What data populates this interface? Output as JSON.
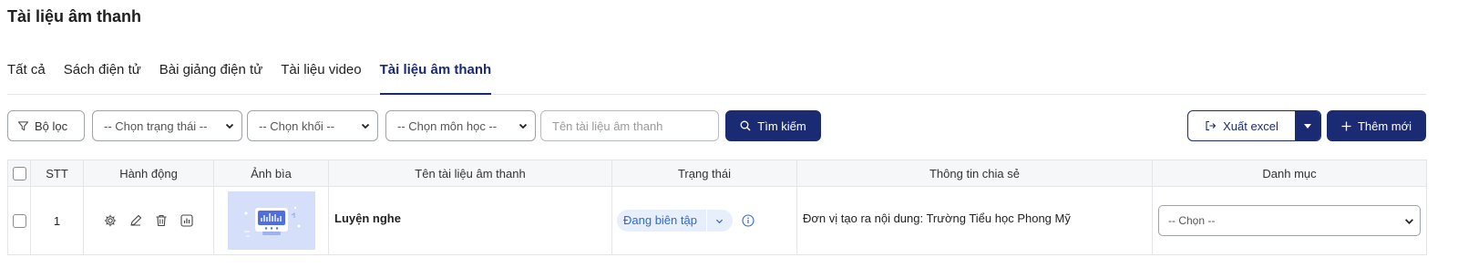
{
  "page": {
    "title": "Tài liệu âm thanh"
  },
  "tabs": [
    {
      "label": "Tất cả",
      "active": false
    },
    {
      "label": "Sách điện tử",
      "active": false
    },
    {
      "label": "Bài giảng điện tử",
      "active": false
    },
    {
      "label": "Tài liệu video",
      "active": false
    },
    {
      "label": "Tài liệu âm thanh",
      "active": true
    }
  ],
  "toolbar": {
    "filter_label": "Bộ lọc",
    "status_select": "-- Chọn trạng thái --",
    "grade_select": "-- Chọn khối --",
    "subject_select": "-- Chọn môn học --",
    "search_placeholder": "Tên tài liệu âm thanh",
    "search_label": "Tìm kiếm",
    "export_label": "Xuất excel",
    "add_label": "Thêm mới"
  },
  "table": {
    "columns": [
      "STT",
      "Hành động",
      "Ảnh bìa",
      "Tên tài liệu âm thanh",
      "Trạng thái",
      "Thông tin chia sẻ",
      "Danh mục"
    ],
    "rows": [
      {
        "stt": "1",
        "name": "Luyện nghe",
        "status": "Đang biên tập",
        "share_info": "Đơn vị tạo ra nội dung: Trường Tiểu học Phong Mỹ",
        "category": "-- Chọn --"
      }
    ]
  },
  "colors": {
    "primary": "#1a2a73",
    "status_bg": "#e7effd",
    "status_text": "#2f68d6",
    "cover_bg": "#d6dffa"
  },
  "icons": [
    "filter-icon",
    "chevron-down-icon",
    "search-icon",
    "export-icon",
    "plus-icon",
    "gear-icon",
    "pencil-icon",
    "trash-icon",
    "chart-icon",
    "info-icon",
    "audio-cover-image"
  ]
}
